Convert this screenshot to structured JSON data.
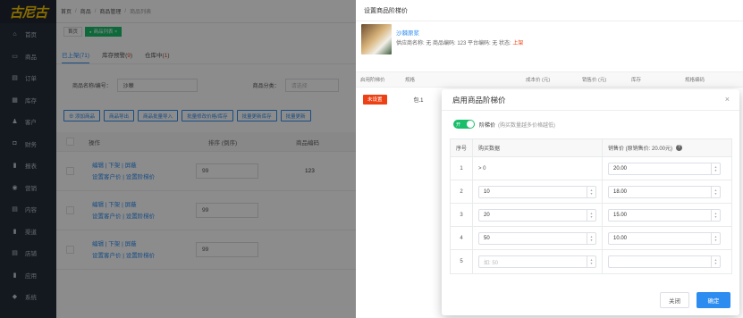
{
  "logo": {
    "text": "古尼古"
  },
  "sidebar": {
    "items": [
      {
        "label": "首页",
        "icon": "home-icon",
        "glyph": "⌂"
      },
      {
        "label": "商品",
        "icon": "cart-icon",
        "glyph": "▭"
      },
      {
        "label": "订单",
        "icon": "order-icon",
        "glyph": "▤"
      },
      {
        "label": "库存",
        "icon": "grid-icon",
        "glyph": "▦"
      },
      {
        "label": "客户",
        "icon": "user-icon",
        "glyph": "♟"
      },
      {
        "label": "财务",
        "icon": "finance-icon",
        "glyph": "◘"
      },
      {
        "label": "报表",
        "icon": "chart-icon",
        "glyph": "▮"
      },
      {
        "label": "营销",
        "icon": "marketing-icon",
        "glyph": "◉"
      },
      {
        "label": "内容",
        "icon": "content-icon",
        "glyph": "▤"
      },
      {
        "label": "渠道",
        "icon": "channel-icon",
        "glyph": "▮"
      },
      {
        "label": "店铺",
        "icon": "store-icon",
        "glyph": "▤"
      },
      {
        "label": "应用",
        "icon": "app-icon",
        "glyph": "▮"
      },
      {
        "label": "系统",
        "icon": "system-icon",
        "glyph": "◆"
      }
    ]
  },
  "breadcrumb": {
    "home": "首页",
    "goods": "商品",
    "manage": "商品管理",
    "current": "商品列表"
  },
  "tags": {
    "home": "首页",
    "list": "商品列表 ×"
  },
  "tabs": [
    {
      "label": "已上架(",
      "count": "71",
      "end": ")"
    },
    {
      "label": "库存预警(",
      "count": "9",
      "end": ")"
    },
    {
      "label": "仓库中(",
      "count": "1",
      "end": ")"
    }
  ],
  "filter": {
    "name_label": "商品名称/编号：",
    "name_value": "沙棘",
    "category_label": "商品分类：",
    "category_placeholder": "请选择"
  },
  "buttons": {
    "add": "⊕ 添加商品",
    "export": "商品导出",
    "import": "商品批量导入",
    "batch_price": "批量修改价格/库存",
    "batch_stock": "批量更新库存",
    "batch_more": "批量更新"
  },
  "grid": {
    "headers": {
      "ops": "操作",
      "sort": "排序 (倒序)",
      "code": "商品编码"
    },
    "rows": [
      {
        "op1": "编辑 | 下架 | 屏蔽",
        "op2": "设置客户价 | 设置阶梯价",
        "sort": "99",
        "code": "123"
      },
      {
        "op1": "编辑 | 下架 | 屏蔽",
        "op2": "设置客户价 | 设置阶梯价",
        "sort": "99",
        "code": ""
      },
      {
        "op1": "编辑 | 下架 | 屏蔽",
        "op2": "设置客户价 | 设置阶梯价",
        "sort": "99",
        "code": ""
      }
    ]
  },
  "drawer": {
    "title": "设置商品阶梯价",
    "product_name": "沙棘原浆",
    "product_meta": "供应商名称: 无    商品编码: 123    平台编码: 无    状态: ",
    "product_status": "上架",
    "headers": {
      "enable": "启用阶梯价",
      "spec": "规格",
      "cost": "成本价 (元)",
      "sale": "销售价 (元)",
      "stock": "库存",
      "code": "规格编码"
    },
    "row_button": "未设置",
    "row_spec": "包.1"
  },
  "modal": {
    "title": "启用商品阶梯价",
    "close": "×",
    "switch_text": "开",
    "switch_label": "阶梯价",
    "switch_hint": "(购买数量越多价格越低)",
    "col_index": "序号",
    "col_qty": "购买数据",
    "col_price": "销售价 (原销售价: 20.00元)",
    "rows": [
      {
        "index": "1",
        "qty": "> 0",
        "price": "20.00"
      },
      {
        "index": "2",
        "qty": "10",
        "price": "18.00"
      },
      {
        "index": "3",
        "qty": "20",
        "price": "15.00"
      },
      {
        "index": "4",
        "qty": "50",
        "price": "10.00"
      },
      {
        "index": "5",
        "qty": "",
        "qty_placeholder": "如: 50",
        "price": ""
      }
    ],
    "cancel": "关闭",
    "confirm": "确定"
  }
}
